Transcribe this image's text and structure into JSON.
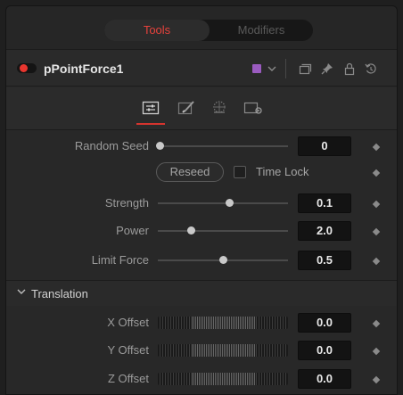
{
  "tabs": {
    "tools": "Tools",
    "modifiers": "Modifiers"
  },
  "node": {
    "name": "pPointForce1",
    "color": "#9a5bbf"
  },
  "controls": {
    "random_seed": {
      "label": "Random Seed",
      "value": "0",
      "level": 0.0
    },
    "reseed_label": "Reseed",
    "time_lock_label": "Time Lock",
    "strength": {
      "label": "Strength",
      "value": "0.1",
      "level": 0.55
    },
    "power": {
      "label": "Power",
      "value": "2.0",
      "level": 0.25
    },
    "limit_force": {
      "label": "Limit Force",
      "value": "0.5",
      "level": 0.5
    }
  },
  "translation": {
    "title": "Translation",
    "x_offset": {
      "label": "X Offset",
      "value": "0.0"
    },
    "y_offset": {
      "label": "Y Offset",
      "value": "0.0"
    },
    "z_offset": {
      "label": "Z Offset",
      "value": "0.0"
    }
  },
  "colors": {
    "accent": "#e6423c",
    "node_toggle": "#e8362f"
  }
}
